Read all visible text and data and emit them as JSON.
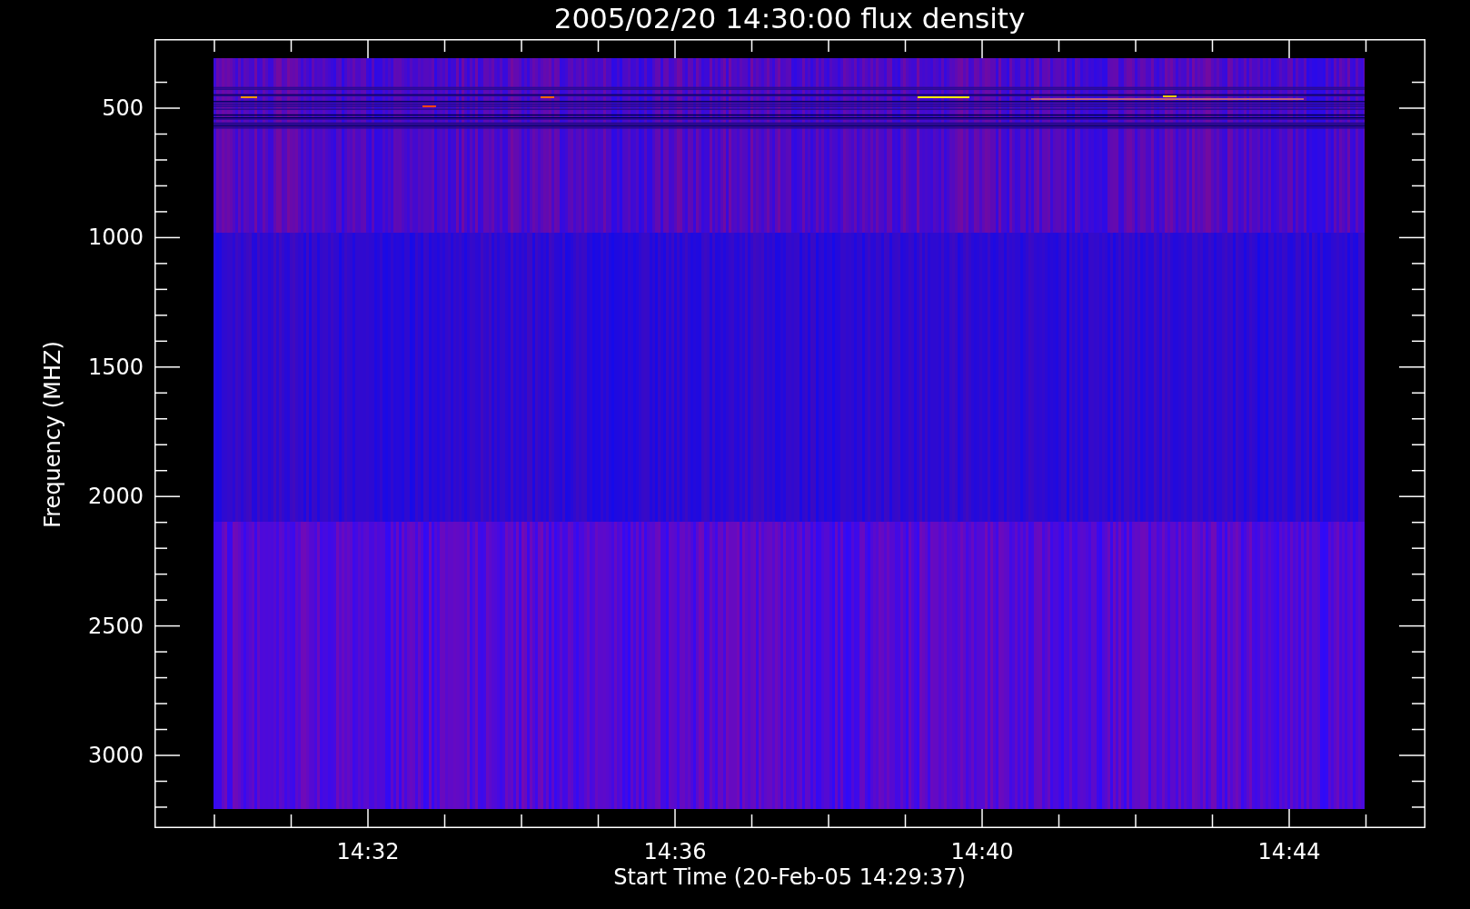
{
  "title": "2005/02/20 14:30:00 flux density",
  "y_axis": {
    "label": "Frequency (MHZ)",
    "ticks": [
      "500",
      "1000",
      "1500",
      "2000",
      "2500",
      "3000"
    ]
  },
  "x_axis": {
    "label": "Start Time (20-Feb-05 14:29:37)",
    "ticks": [
      "14:32",
      "14:36",
      "14:40",
      "14:44"
    ]
  }
}
